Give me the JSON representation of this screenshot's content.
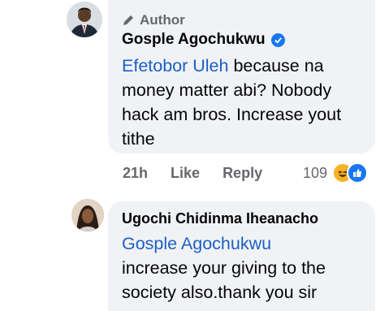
{
  "comment1": {
    "badge": "Author",
    "author": "Gosple Agochukwu",
    "mention": "Efetobor Uleh",
    "text": " because na money matter abi? Nobody hack am bros. Increase yout tithe",
    "time": "21h",
    "like_label": "Like",
    "reply_label": "Reply",
    "reaction_count": "109",
    "reactions": [
      "haha-icon",
      "like-icon"
    ]
  },
  "comment2": {
    "author": "Ugochi Chidinma Iheanacho",
    "mention": "Gosple Agochukwu",
    "text": "increase your giving to the society also.thank you sir"
  },
  "colors": {
    "bubble": "#f0f2f5",
    "mention": "#1c5fc6",
    "verified": "#1877f2",
    "meta": "#65676b"
  }
}
